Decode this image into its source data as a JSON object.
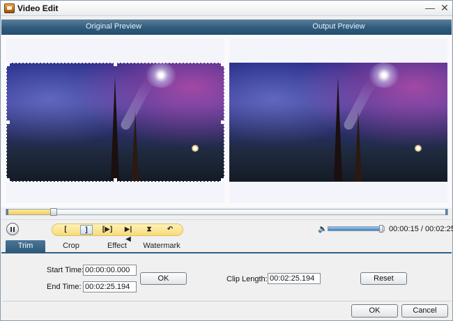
{
  "window": {
    "title": "Video Edit",
    "minimize_glyph": "—",
    "close_glyph": "✕"
  },
  "preview": {
    "original_label": "Original Preview",
    "output_label": "Output Preview"
  },
  "timeline": {
    "progress_fraction": 0.1
  },
  "playback": {
    "tools": [
      {
        "glyph": "[",
        "active": false
      },
      {
        "glyph": "]",
        "active": true
      },
      {
        "glyph": "[▶]",
        "active": false
      },
      {
        "glyph": "▶|◀",
        "active": false
      },
      {
        "glyph": "⧗",
        "active": false
      },
      {
        "glyph": "↶",
        "active": false
      }
    ],
    "volume_fraction": 0.95,
    "current_time": "00:00:15",
    "separator": " / ",
    "total_time": "00:02:25"
  },
  "tabs": [
    {
      "label": "Trim",
      "active": true
    },
    {
      "label": "Crop",
      "active": false
    },
    {
      "label": "Effect",
      "active": false
    },
    {
      "label": "Watermark",
      "active": false
    }
  ],
  "trim": {
    "start_label": "Start Time:",
    "start_value": "00:00:00.000",
    "end_label": "End Time:",
    "end_value": "00:02:25.194",
    "ok_label": "OK",
    "clip_length_label": "Clip Length:",
    "clip_length_value": "00:02:25.194",
    "reset_label": "Reset"
  },
  "footer": {
    "ok_label": "OK",
    "cancel_label": "Cancel"
  },
  "icons": {
    "app": "app-logo-icon",
    "pause": "pause-icon",
    "volume": "speaker-icon"
  },
  "colors": {
    "header_blue": "#2f5a7c",
    "tool_strip": "#f7db78",
    "timeline_fill": "#f5cf58"
  }
}
